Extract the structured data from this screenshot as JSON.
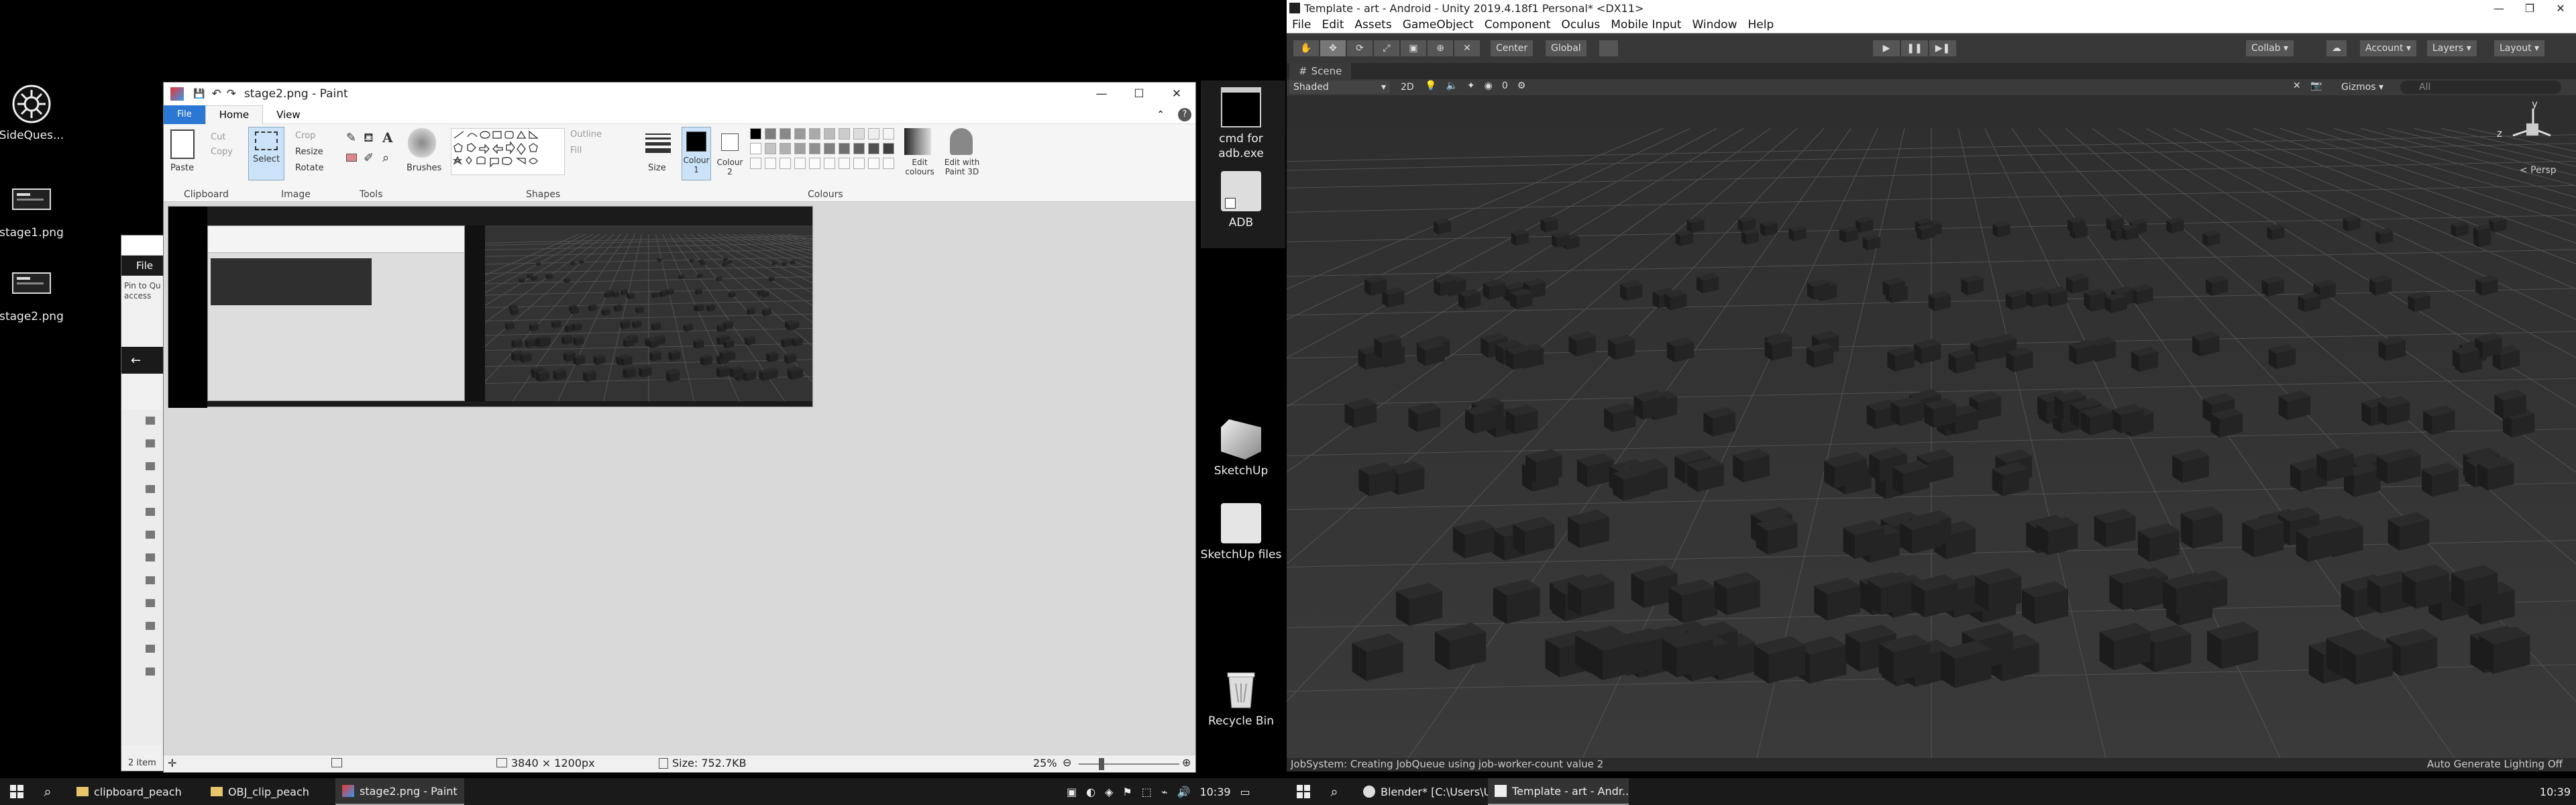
{
  "desktop_left": {
    "icons": [
      {
        "label": "SideQues...",
        "icon": "sidequest-icon"
      },
      {
        "label": "stage1.png",
        "icon": "image-file-icon"
      },
      {
        "label": "stage2.png",
        "icon": "image-file-icon"
      }
    ]
  },
  "desktop_middle": {
    "icons": [
      {
        "label": "cmd for adb.exe",
        "icon": "cmd-icon"
      },
      {
        "label": "ADB",
        "icon": "folder-shortcut-icon"
      },
      {
        "label": "SketchUp",
        "icon": "sketchup-icon"
      },
      {
        "label": "SketchUp files",
        "icon": "sketchup-files-icon"
      },
      {
        "label": "Recycle Bin",
        "icon": "recycle-bin-icon"
      }
    ]
  },
  "explorer_partial": {
    "file_tab": "File",
    "pin_text": "Pin to Qu access",
    "items_count": "2 item"
  },
  "paint": {
    "title": "stage2.png - Paint",
    "tabs": [
      "File",
      "Home",
      "View"
    ],
    "clipboard": {
      "paste": "Paste",
      "cut": "Cut",
      "copy": "Copy",
      "label": "Clipboard"
    },
    "image": {
      "select": "Select",
      "crop": "Crop",
      "resize": "Resize",
      "rotate": "Rotate",
      "label": "Image"
    },
    "tools": {
      "label": "Tools"
    },
    "brushes": "Brushes",
    "shapes": {
      "outline": "Outline",
      "fill": "Fill",
      "label": "Shapes"
    },
    "size": "Size",
    "colour1": "Colour 1",
    "colour2": "Colour 2",
    "edit_colours": "Edit colours",
    "edit_paint3d": "Edit with Paint 3D",
    "colours_label": "Colours",
    "status": {
      "dimensions": "3840 × 1200px",
      "size": "Size: 752.7KB",
      "zoom": "25%"
    },
    "palette": [
      "#000000",
      "#7f7f7f",
      "#888888",
      "#999999",
      "#aaaaaa",
      "#bbbbbb",
      "#cccccc",
      "#dddddd",
      "#eeeeee",
      "#f5f5f5",
      "#ffffff",
      "#c3c3c3",
      "#b0b0b0",
      "#a0a0a0",
      "#909090",
      "#808080",
      "#707070",
      "#606060",
      "#505050",
      "#404040"
    ]
  },
  "unity": {
    "title": "Template - art - Android - Unity 2019.4.18f1 Personal* <DX11>",
    "menu": [
      "File",
      "Edit",
      "Assets",
      "GameObject",
      "Component",
      "Oculus",
      "Mobile Input",
      "Window",
      "Help"
    ],
    "toolbar": {
      "center": "Center",
      "global": "Global",
      "collab": "Collab",
      "account": "Account",
      "layers": "Layers",
      "layout": "Layout"
    },
    "scene_tab": "Scene",
    "scene_controls": {
      "shaded": "Shaded",
      "mode2d": "2D",
      "gizmos": "Gizmos",
      "search_placeholder": "All",
      "counter": "0"
    },
    "gizmo": {
      "y": "y",
      "z": "z",
      "persp": "< Persp"
    },
    "status": {
      "message": "JobSystem: Creating JobQueue using job-worker-count value 2",
      "lighting": "Auto Generate Lighting Off"
    }
  },
  "taskbar_left": {
    "items": [
      {
        "label": "clipboard_peach",
        "icon": "folder-icon"
      },
      {
        "label": "OBJ_clip_peach",
        "icon": "folder-icon"
      },
      {
        "label": "stage2.png - Paint",
        "icon": "paint-icon"
      }
    ],
    "clock": "10:39"
  },
  "taskbar_right": {
    "items": [
      {
        "label": "Blender* [C:\\Users\\Us...",
        "icon": "blender-icon"
      },
      {
        "label": "Template - art - Andr...",
        "icon": "unity-icon"
      }
    ],
    "clock": "10:39"
  }
}
